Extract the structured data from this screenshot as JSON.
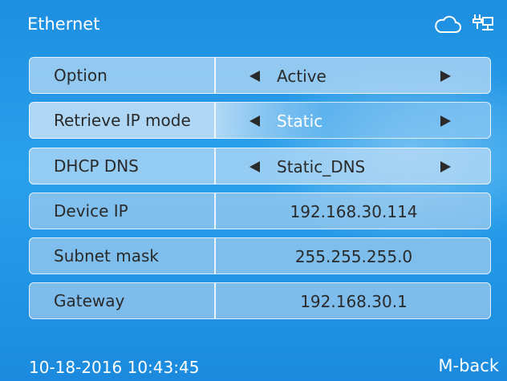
{
  "header": {
    "title": "Ethernet",
    "icons": [
      "cloud-icon",
      "network-plug-icon"
    ]
  },
  "rows": [
    {
      "label": "Option",
      "value": "Active",
      "type": "selector"
    },
    {
      "label": "Retrieve IP mode",
      "value": "Static",
      "type": "selector",
      "selected": true
    },
    {
      "label": "DHCP DNS",
      "value": "Static_DNS",
      "type": "selector"
    },
    {
      "label": "Device IP",
      "value": "192.168.30.114",
      "type": "readonly"
    },
    {
      "label": "Subnet mask",
      "value": "255.255.255.0",
      "type": "readonly"
    },
    {
      "label": "Gateway",
      "value": "192.168.30.1",
      "type": "readonly"
    }
  ],
  "footer": {
    "datetime": "10-18-2016 10:43:45",
    "back_label": "M-back"
  },
  "colors": {
    "background": "#1e8fe0",
    "text": "#2a2a2a",
    "highlight_text": "#ffffff"
  }
}
